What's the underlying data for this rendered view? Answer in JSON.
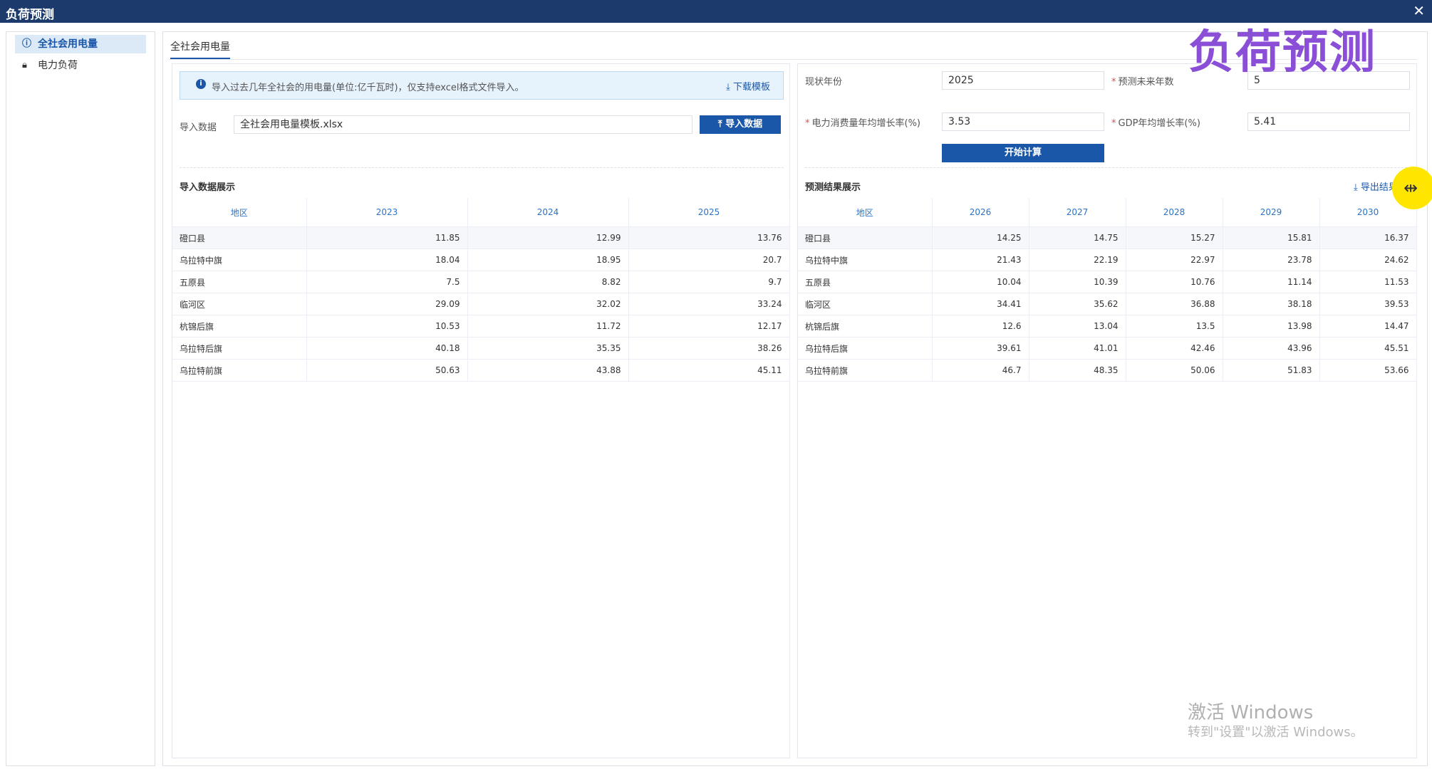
{
  "window": {
    "title": "负荷预测",
    "close_icon": "close-icon"
  },
  "sidebar": {
    "items": [
      {
        "label": "全社会用电量",
        "icon": "info-circle-icon",
        "active": true
      },
      {
        "label": "电力负荷",
        "icon": "lock-icon",
        "active": false
      }
    ]
  },
  "tabs": [
    {
      "label": "全社会用电量"
    }
  ],
  "import": {
    "notice": "导入过去几年全社会的用电量(单位:亿千瓦时)，仅支持excel格式文件导入。",
    "download_label": "下载模板",
    "row_label": "导入数据",
    "file_value": "全社会用电量模板.xlsx",
    "import_button": "导入数据",
    "section_title": "导入数据展示",
    "table": {
      "headers": [
        "地区",
        "2023",
        "2024",
        "2025"
      ],
      "rows": [
        [
          "磴口县",
          "11.85",
          "12.99",
          "13.76"
        ],
        [
          "乌拉特中旗",
          "18.04",
          "18.95",
          "20.7"
        ],
        [
          "五原县",
          "7.5",
          "8.82",
          "9.7"
        ],
        [
          "临河区",
          "29.09",
          "32.02",
          "33.24"
        ],
        [
          "杭锦后旗",
          "10.53",
          "11.72",
          "12.17"
        ],
        [
          "乌拉特后旗",
          "40.18",
          "35.35",
          "38.26"
        ],
        [
          "乌拉特前旗",
          "50.63",
          "43.88",
          "45.11"
        ]
      ]
    }
  },
  "forecast": {
    "current_year_label": "现状年份",
    "current_year_value": "2025",
    "future_years_label": "预测未来年数",
    "future_years_value": "5",
    "power_growth_label": "电力消费量年均增长率(%)",
    "power_growth_value": "3.53",
    "gdp_growth_label": "GDP年均增长率(%)",
    "gdp_growth_value": "5.41",
    "calc_button": "开始计算",
    "section_title": "预测结果展示",
    "export_label": "导出结果",
    "table": {
      "headers": [
        "地区",
        "2026",
        "2027",
        "2028",
        "2029",
        "2030"
      ],
      "rows": [
        [
          "磴口县",
          "14.25",
          "14.75",
          "15.27",
          "15.81",
          "16.37"
        ],
        [
          "乌拉特中旗",
          "21.43",
          "22.19",
          "22.97",
          "23.78",
          "24.62"
        ],
        [
          "五原县",
          "10.04",
          "10.39",
          "10.76",
          "11.14",
          "11.53"
        ],
        [
          "临河区",
          "34.41",
          "35.62",
          "36.88",
          "38.18",
          "39.53"
        ],
        [
          "杭锦后旗",
          "12.6",
          "13.04",
          "13.5",
          "13.98",
          "14.47"
        ],
        [
          "乌拉特后旗",
          "39.61",
          "41.01",
          "42.46",
          "43.96",
          "45.51"
        ],
        [
          "乌拉特前旗",
          "46.7",
          "48.35",
          "50.06",
          "51.83",
          "53.66"
        ]
      ]
    }
  },
  "overlay": {
    "title": "负荷预测",
    "windows_line1": "激活 Windows",
    "windows_line2": "转到\"设置\"以激活 Windows。",
    "accent_color": "#8a4fd6",
    "cursor_color": "#ffe600"
  },
  "colors": {
    "titlebar": "#1c3a6b",
    "primary": "#1a57a8",
    "header_text": "#2a73c9"
  }
}
